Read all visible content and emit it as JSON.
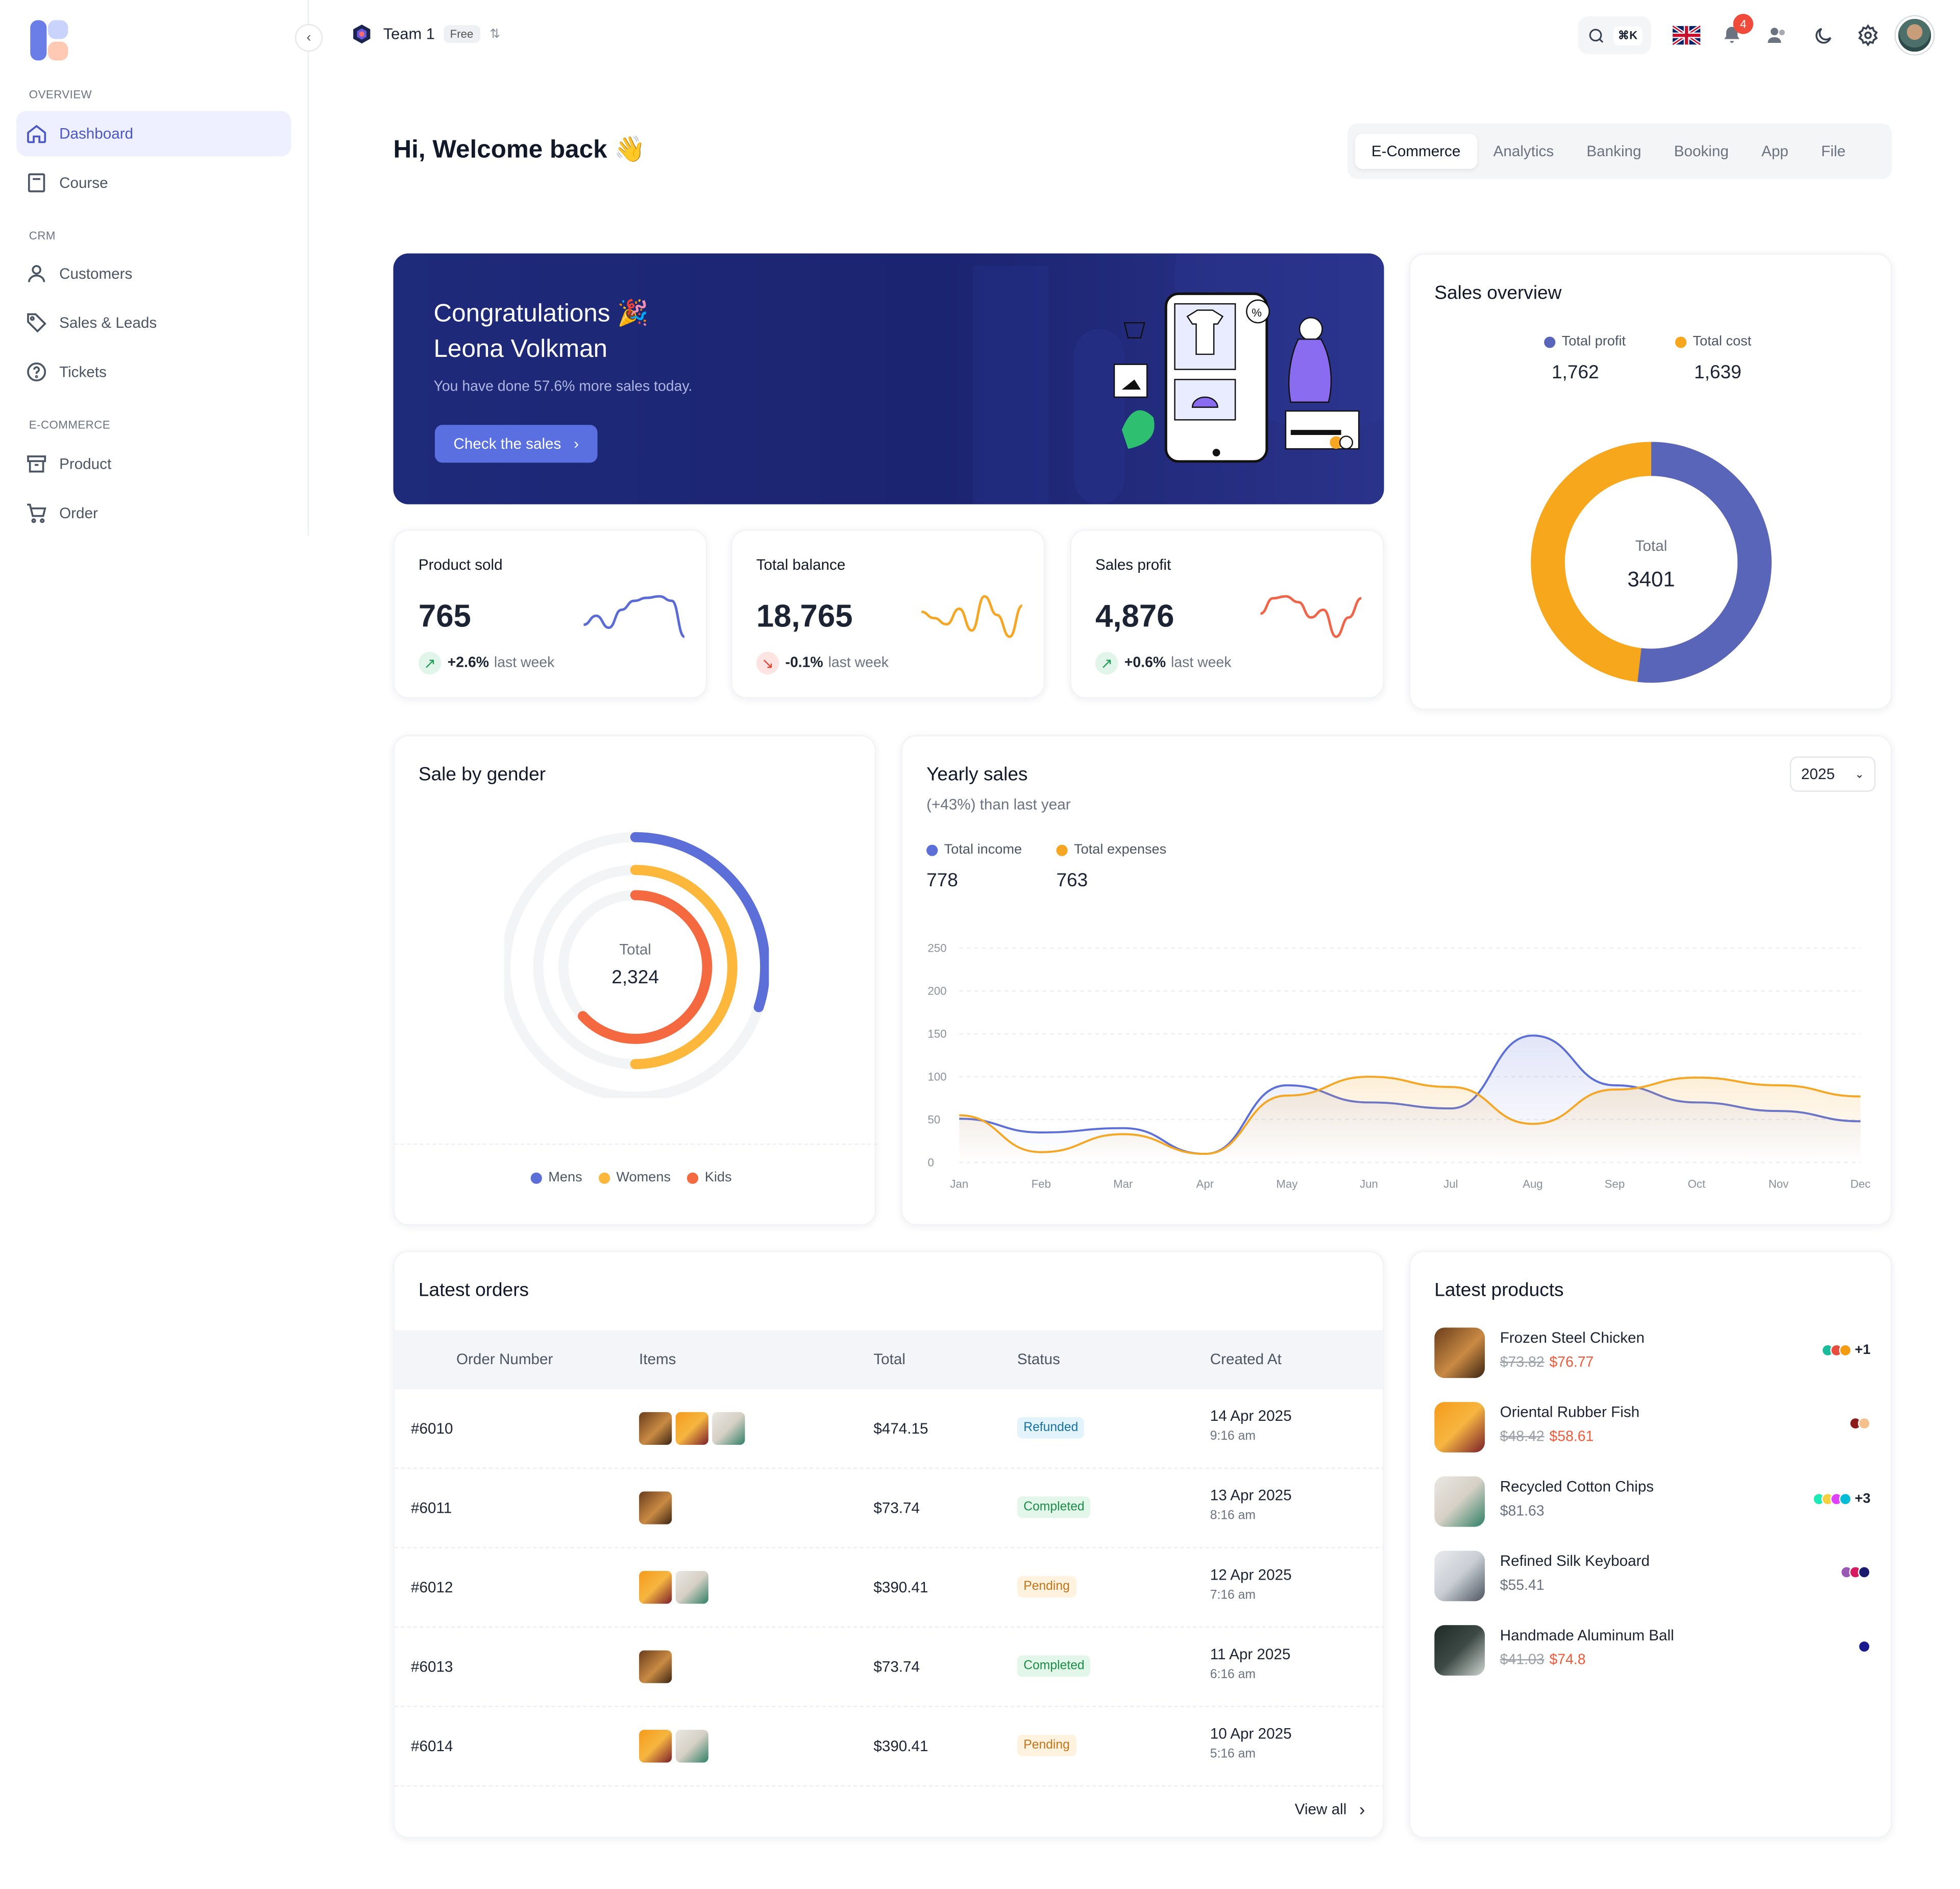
{
  "sidebar": {
    "sections": [
      "OVERVIEW",
      "CRM",
      "E-COMMERCE"
    ],
    "items": [
      {
        "label": "Dashboard",
        "icon": "home-icon",
        "active": true
      },
      {
        "label": "Course",
        "icon": "book-icon"
      },
      {
        "label": "Customers",
        "icon": "user-icon"
      },
      {
        "label": "Sales & Leads",
        "icon": "tag-icon"
      },
      {
        "label": "Tickets",
        "icon": "help-circle-icon"
      },
      {
        "label": "Product",
        "icon": "archive-icon"
      },
      {
        "label": "Order",
        "icon": "cart-icon"
      }
    ]
  },
  "header": {
    "team_name": "Team 1",
    "plan": "Free",
    "search_shortcut": "⌘K",
    "notification_count": "4",
    "language_flag": "uk-flag-icon"
  },
  "welcome": "Hi, Welcome back 👋",
  "tabs": [
    "E-Commerce",
    "Analytics",
    "Banking",
    "Booking",
    "App",
    "File"
  ],
  "banner": {
    "line1": "Congratulations 🎉",
    "line2": "Leona Volkman",
    "subtitle": "You have done 57.6% more sales today.",
    "button": "Check the sales"
  },
  "stats": [
    {
      "title": "Product sold",
      "value": "765",
      "change": "+2.6%",
      "suffix": "last week",
      "trend": "up",
      "color": "#5b6bd6",
      "spark": [
        12,
        18,
        10,
        22,
        28,
        30,
        31,
        28,
        4
      ]
    },
    {
      "title": "Total balance",
      "value": "18,765",
      "change": "-0.1%",
      "suffix": "last week",
      "trend": "down",
      "color": "#f5a623",
      "spark": [
        22,
        18,
        14,
        24,
        10,
        32,
        20,
        6,
        26
      ]
    },
    {
      "title": "Sales profit",
      "value": "4,876",
      "change": "+0.6%",
      "suffix": "last week",
      "trend": "up",
      "color": "#f0654a",
      "spark": [
        20,
        28,
        29,
        26,
        18,
        22,
        8,
        18,
        28
      ]
    }
  ],
  "sales_overview": {
    "title": "Sales overview",
    "legend": [
      {
        "label": "Total profit",
        "value": "1,762",
        "color": "#5865b8"
      },
      {
        "label": "Total cost",
        "value": "1,639",
        "color": "#f7a71b"
      }
    ],
    "center_label": "Total",
    "center_value": "3401"
  },
  "gender": {
    "title": "Sale by gender",
    "center_label": "Total",
    "center_value": "2,324",
    "legend": [
      {
        "label": "Mens",
        "color": "#5c6fd8",
        "fraction": 0.3
      },
      {
        "label": "Womens",
        "color": "#fdb73a",
        "fraction": 0.5
      },
      {
        "label": "Kids",
        "color": "#f4693f",
        "fraction": 0.63
      }
    ]
  },
  "yearly": {
    "title": "Yearly sales",
    "subtitle": "(+43%) than last year",
    "year": "2025",
    "legend": [
      {
        "label": "Total income",
        "value": "778",
        "color": "#5c6fd8"
      },
      {
        "label": "Total expenses",
        "value": "763",
        "color": "#f5a623"
      }
    ]
  },
  "chart_data": {
    "type": "area",
    "x": [
      "Jan",
      "Feb",
      "Mar",
      "Apr",
      "May",
      "Jun",
      "Jul",
      "Aug",
      "Sep",
      "Oct",
      "Nov",
      "Dec"
    ],
    "ylim": [
      0,
      250
    ],
    "yticks": [
      0,
      50,
      100,
      150,
      200,
      250
    ],
    "series": [
      {
        "name": "Total income",
        "color": "#5c6fd8",
        "values": [
          51,
          35,
          40,
          10,
          90,
          70,
          63,
          148,
          90,
          70,
          60,
          48
        ]
      },
      {
        "name": "Total expenses",
        "color": "#f5a623",
        "values": [
          55,
          12,
          33,
          10,
          78,
          100,
          88,
          45,
          85,
          99,
          90,
          77
        ]
      }
    ]
  },
  "orders": {
    "title": "Latest orders",
    "columns": [
      "Order Number",
      "Items",
      "Total",
      "Status",
      "Created At"
    ],
    "rows": [
      {
        "id": "#6010",
        "items": [
          "brown",
          "orange",
          "green"
        ],
        "total": "$474.15",
        "status": "Refunded",
        "date": "14 Apr 2025",
        "time": "9:16 am"
      },
      {
        "id": "#6011",
        "items": [
          "brown"
        ],
        "total": "$73.74",
        "status": "Completed",
        "date": "13 Apr 2025",
        "time": "8:16 am"
      },
      {
        "id": "#6012",
        "items": [
          "orange",
          "green"
        ],
        "total": "$390.41",
        "status": "Pending",
        "date": "12 Apr 2025",
        "time": "7:16 am"
      },
      {
        "id": "#6013",
        "items": [
          "brown"
        ],
        "total": "$73.74",
        "status": "Completed",
        "date": "11 Apr 2025",
        "time": "6:16 am"
      },
      {
        "id": "#6014",
        "items": [
          "orange",
          "green"
        ],
        "total": "$390.41",
        "status": "Pending",
        "date": "10 Apr 2025",
        "time": "5:16 am"
      }
    ],
    "view_all": "View all"
  },
  "products": {
    "title": "Latest products",
    "items": [
      {
        "name": "Frozen Steel Chicken",
        "old": "$73.82",
        "price": "$76.77",
        "colors": [
          "#1abc9c",
          "#e74c3c",
          "#f39c12"
        ],
        "extra": "+1",
        "img": "brown"
      },
      {
        "name": "Oriental Rubber Fish",
        "old": "$48.42",
        "price": "$58.61",
        "colors": [
          "#8b1a1a",
          "#f6c08c"
        ],
        "extra": "",
        "img": "orange"
      },
      {
        "name": "Recycled Cotton Chips",
        "old": "",
        "price": "$81.63",
        "colors": [
          "#1de9b6",
          "#f4d03f",
          "#e040fb",
          "#00bcd4"
        ],
        "extra": "+3",
        "img": "green"
      },
      {
        "name": "Refined Silk Keyboard",
        "old": "",
        "price": "$55.41",
        "colors": [
          "#9b59b6",
          "#d81b60",
          "#1a1a6e"
        ],
        "extra": "",
        "img": "grey"
      },
      {
        "name": "Handmade Aluminum Ball",
        "old": "$41.03",
        "price": "$74.8",
        "colors": [
          "#1a1a8e"
        ],
        "extra": "",
        "img": "dark"
      }
    ]
  }
}
